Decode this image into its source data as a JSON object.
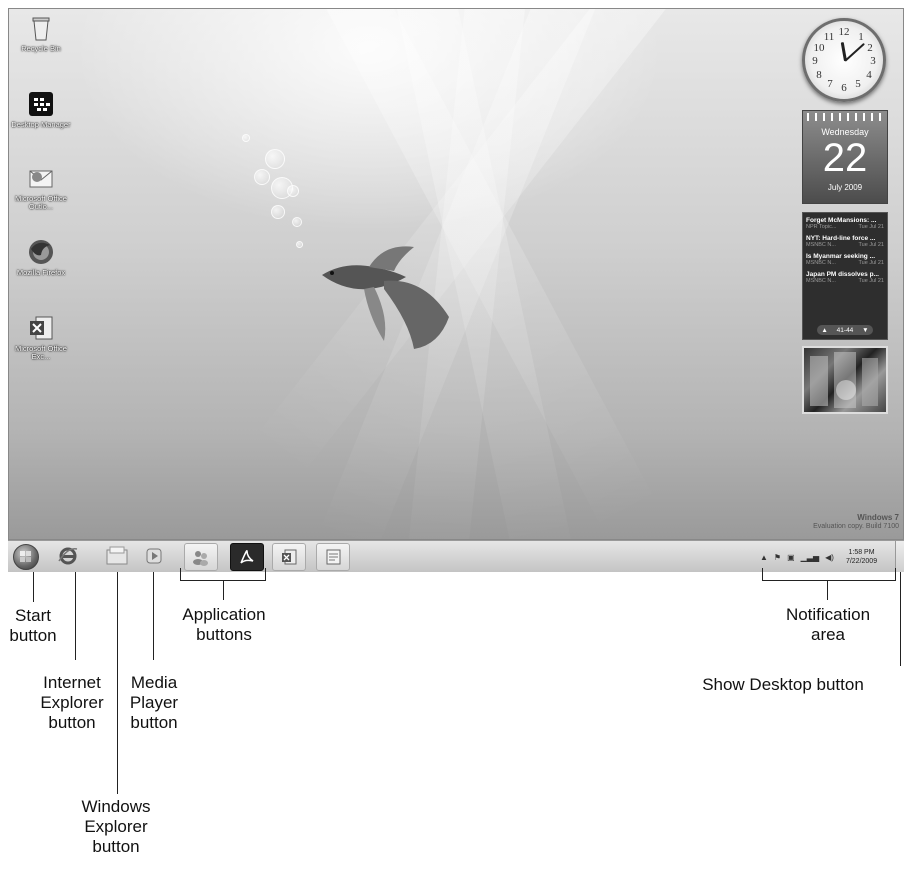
{
  "desktop": {
    "icons": [
      {
        "label": "Recycle Bin",
        "icon": "recycle-bin-icon"
      },
      {
        "label": "Desktop Manager",
        "icon": "desktop-manager-icon"
      },
      {
        "label": "Microsoft Office Outlo...",
        "icon": "outlook-icon"
      },
      {
        "label": "Mozilla Firefox",
        "icon": "firefox-icon"
      },
      {
        "label": "Microsoft Office Exc...",
        "icon": "excel-icon"
      }
    ],
    "watermark": {
      "line1": "Windows 7",
      "line2": "Evaluation copy. Build 7100"
    }
  },
  "gadgets": {
    "clock": {
      "numbers": [
        "12",
        "1",
        "2",
        "3",
        "4",
        "5",
        "6",
        "7",
        "8",
        "9",
        "10",
        "11"
      ],
      "time": "1:58"
    },
    "calendar": {
      "weekday": "Wednesday",
      "date": "22",
      "month_year": "July 2009"
    },
    "feeds": {
      "items": [
        {
          "title": "Forget McMansions: ...",
          "source": "NPR Topic...",
          "date": "Tue Jul 21"
        },
        {
          "title": "NYT: Hard-line force ...",
          "source": "MSNBC N...",
          "date": "Tue Jul 21"
        },
        {
          "title": "Is Myanmar seeking ...",
          "source": "MSNBC N...",
          "date": "Tue Jul 21"
        },
        {
          "title": "Japan PM dissolves p...",
          "source": "MSNBC N...",
          "date": "Tue Jul 21"
        }
      ],
      "pager": "41-44",
      "prev_icon": "up-arrow-icon",
      "next_icon": "down-arrow-icon"
    }
  },
  "taskbar": {
    "tray_time": "1:58 PM",
    "tray_date": "7/22/2009",
    "tray_icons": [
      "show-hidden-icon",
      "flag-icon",
      "network-icon",
      "signal-icon",
      "volume-icon"
    ]
  },
  "callouts": {
    "start": [
      "Start",
      "button"
    ],
    "ie": [
      "Internet",
      "Explorer",
      "button"
    ],
    "explorer": [
      "Windows",
      "Explorer",
      "button"
    ],
    "media": [
      "Media",
      "Player",
      "button"
    ],
    "apps": [
      "Application",
      "buttons"
    ],
    "notify": [
      "Notification",
      "area"
    ],
    "show_desktop": "Show Desktop button"
  },
  "colors": {
    "taskbar": "#d6d6d6",
    "label_text": "#111111"
  }
}
